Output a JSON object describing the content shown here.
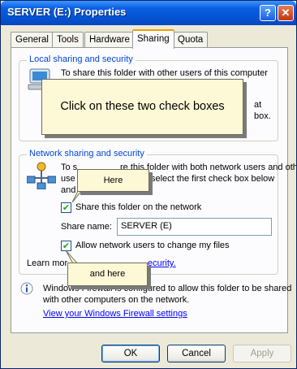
{
  "window": {
    "title": "SERVER (E:) Properties",
    "help_glyph": "?",
    "close_glyph": "✕"
  },
  "tabs": [
    {
      "label": "General"
    },
    {
      "label": "Tools"
    },
    {
      "label": "Hardware"
    },
    {
      "label": "Sharing",
      "active": true
    },
    {
      "label": "Quota"
    }
  ],
  "local": {
    "legend": "Local sharing and security",
    "line1": "To share this folder with other users of this computer",
    "frag1": "at",
    "frag2": "box."
  },
  "network": {
    "legend": "Network sharing and security",
    "line1a": "To s",
    "line1b": "re this folder with both network users and other",
    "line2a": "use",
    "line2b": "select the first check box below",
    "line3a": "and",
    "share_checkbox": {
      "label": "Share this folder on the network",
      "checked": true
    },
    "share_name_label": "Share name:",
    "share_name_value": "SERVER (E)",
    "allow_checkbox": {
      "label": "Allow network users to change my files",
      "checked": true
    },
    "learn_prefix": "Learn mor",
    "learn_link": "ecurity."
  },
  "firewall": {
    "text1": "Windows Firewall is configured to allow this folder to be shared",
    "text2": "with other computers on the network.",
    "link": "View your Windows Firewall settings"
  },
  "buttons": {
    "ok": "OK",
    "cancel": "Cancel",
    "apply": "Apply"
  },
  "callouts": {
    "main": "Click on these two check boxes",
    "here": "Here",
    "and_here": "and here"
  }
}
